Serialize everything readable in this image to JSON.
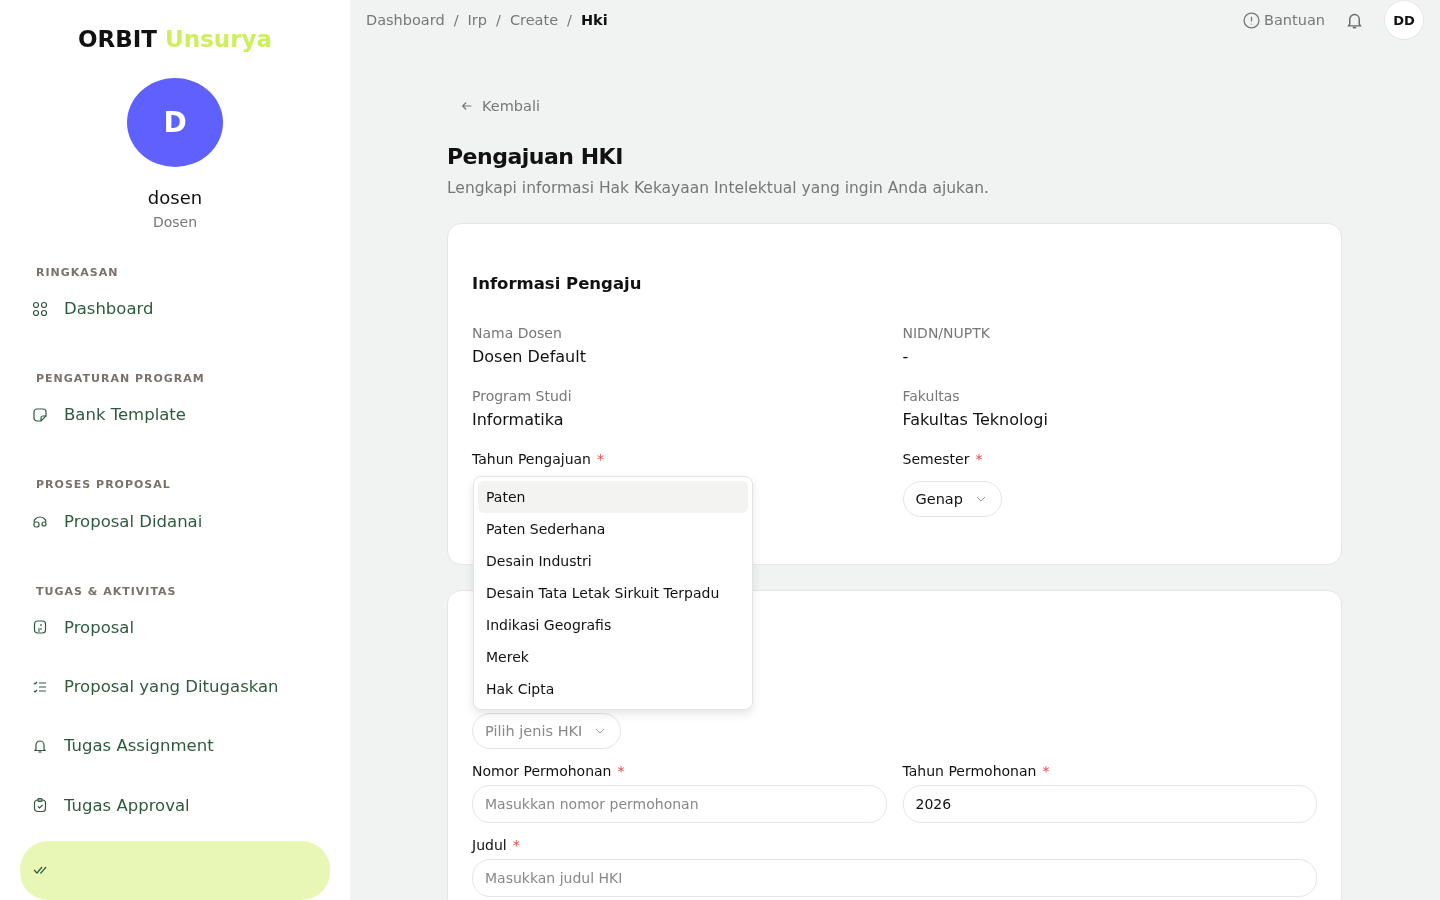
{
  "sidebar": {
    "logo": {
      "main": "ORBIT",
      "accent": "Unsurya"
    },
    "user": {
      "initial": "D",
      "name": "dosen",
      "role": "Dosen"
    },
    "sections": [
      {
        "title": "RINGKASAN",
        "items": [
          {
            "label": "Dashboard",
            "selected": false
          }
        ]
      },
      {
        "title": "PENGATURAN PROGRAM",
        "items": [
          {
            "label": "Bank Template",
            "selected": false
          }
        ]
      },
      {
        "title": "PROSES PROPOSAL",
        "items": [
          {
            "label": "Proposal Didanai",
            "selected": false
          }
        ]
      },
      {
        "title": "TUGAS & AKTIVITAS",
        "items": [
          {
            "label": "Proposal",
            "selected": false
          },
          {
            "label": "Proposal yang Ditugaskan",
            "selected": false
          },
          {
            "label": "Tugas Assignment",
            "selected": false
          },
          {
            "label": "Tugas Approval",
            "selected": false
          },
          {
            "selected": true
          }
        ]
      }
    ]
  },
  "breadcrumb": [
    {
      "label": "Dashboard",
      "current": false
    },
    {
      "separator": "/",
      "label": "Irp",
      "current": false
    },
    {
      "separator": "/",
      "label": "Create",
      "current": false
    },
    {
      "separator": "/",
      "label": "Hki",
      "current": true
    }
  ],
  "required_mark": "*",
  "header": {
    "help": "Bantuan",
    "avatar": "DD"
  },
  "back": "Kembali",
  "title": "Pengajuan HKI",
  "subtitle": "Lengkapi informasi Hak Kekayaan Intelektual yang ingin Anda ajukan.",
  "applicant": {
    "title": "Informasi Pengaju",
    "fields": [
      {
        "label": "Nama Dosen",
        "value": "Dosen Default"
      },
      {
        "label": "NIDN/NUPTK",
        "value": "-"
      },
      {
        "label": "Program Studi",
        "value": "Informatika"
      },
      {
        "label": "Fakultas",
        "value": "Fakultas Teknologi"
      }
    ],
    "year_label": "Tahun Pengajuan",
    "semester_label": "Semester",
    "semester_value": "Genap"
  },
  "dropdown": [
    {
      "label": "Paten",
      "selected": true
    },
    {
      "label": "Paten Sederhana",
      "selected": false
    },
    {
      "label": "Desain Industri",
      "selected": false
    },
    {
      "label": "Desain Tata Letak Sirkuit Terpadu",
      "selected": false
    },
    {
      "label": "Indikasi Geografis",
      "selected": false
    },
    {
      "label": "Merek",
      "selected": false
    },
    {
      "label": "Hak Cipta",
      "selected": false
    }
  ],
  "detail": {
    "type_placeholder": "Pilih jenis HKI",
    "fields": [
      {
        "label": "Nomor Permohonan",
        "placeholder": "Masukkan nomor permohonan"
      },
      {
        "label": "Tahun Permohonan",
        "value": "2026"
      }
    ],
    "title_field": {
      "label": "Judul",
      "placeholder": "Masukkan judul HKI"
    }
  }
}
